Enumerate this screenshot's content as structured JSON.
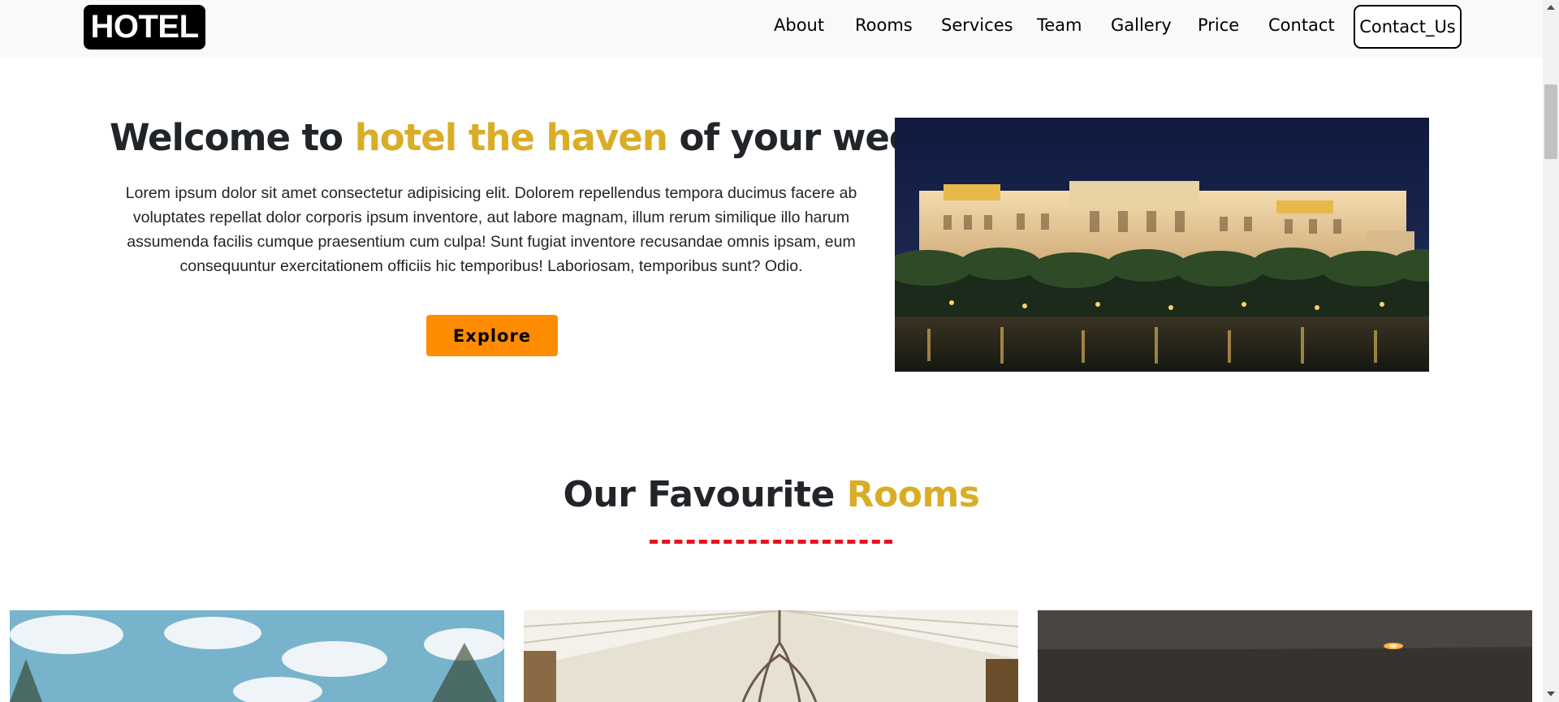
{
  "navbar": {
    "brand": "HOTEL",
    "links": [
      "About",
      "Rooms",
      "Services",
      "Team",
      "Gallery",
      "Price",
      "Contact"
    ],
    "cta_label": "Contact_Us"
  },
  "hero": {
    "title_part1": "Welcome to ",
    "title_accent": "hotel the haven",
    "title_part2": " of your weekend",
    "description": "Lorem ipsum dolor sit amet consectetur adipisicing elit. Dolorem repellendus tempora ducimus facere ab voluptates repellat dolor corporis ipsum inventore, aut labore magnam, illum rerum similique illo harum assumenda facilis cumque praesentium cum culpa! Sunt fugiat inventore recusandae omnis ipsam, eum consequuntur exercitationem officiis hic temporibus! Laboriosam, temporibus sunt? Odio.",
    "button_label": "Explore"
  },
  "rooms": {
    "title_part1": "Our Favourite ",
    "title_accent": "Rooms"
  },
  "colors": {
    "accent": "#d9ad26",
    "button": "#ff8c00",
    "underline": "#e8121c",
    "brand_bg": "#000000",
    "navbar_bg": "#f8f9fa"
  }
}
